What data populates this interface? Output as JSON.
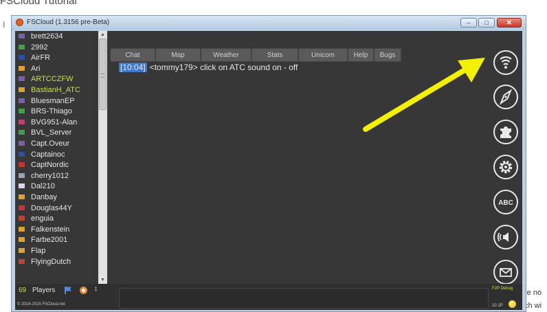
{
  "page": {
    "title": "FSCloud Tutorial",
    "side_text": "I",
    "right_text_1": "re no",
    "right_text_2": "ch wi"
  },
  "window": {
    "title": "FSCloud (1.3156 pre-Beta)",
    "buttons": {
      "minimize": "–",
      "maximize": "□",
      "close": "✕"
    }
  },
  "players": {
    "items": [
      {
        "name": "brett2634",
        "flag": "#7a5fb0",
        "atc": false
      },
      {
        "name": "2992",
        "flag": "#3fa04a",
        "atc": false
      },
      {
        "name": "AirFR",
        "flag": "#2a4fb0",
        "atc": false
      },
      {
        "name": "Ari",
        "flag": "#e2a12a",
        "atc": false
      },
      {
        "name": "ARTCCZFW",
        "flag": "#7a5fb0",
        "atc": true
      },
      {
        "name": "BastianH_ATC",
        "flag": "#e2a12a",
        "atc": true
      },
      {
        "name": "BluesmanEP",
        "flag": "#7a5fb0",
        "atc": false
      },
      {
        "name": "BRS-Thiago",
        "flag": "#3fa04a",
        "atc": false
      },
      {
        "name": "BVG951-Alan",
        "flag": "#c04070",
        "atc": false
      },
      {
        "name": "BVL_Server",
        "flag": "#3fa04a",
        "atc": false
      },
      {
        "name": "Capt.Oveur",
        "flag": "#7a5fb0",
        "atc": false
      },
      {
        "name": "Captainoc",
        "flag": "#2a4fb0",
        "atc": false
      },
      {
        "name": "CaptNordic",
        "flag": "#d03030",
        "atc": false
      },
      {
        "name": "cherry1012",
        "flag": "#9aa0b8",
        "atc": false
      },
      {
        "name": "Dal210",
        "flag": "#d8d8e8",
        "atc": false
      },
      {
        "name": "Danbay",
        "flag": "#e2a12a",
        "atc": false
      },
      {
        "name": "Douglas44Y",
        "flag": "#d03030",
        "atc": false
      },
      {
        "name": "enguia",
        "flag": "#c04030",
        "atc": false
      },
      {
        "name": "Falkenstein",
        "flag": "#e2a12a",
        "atc": false
      },
      {
        "name": "Farbe2001",
        "flag": "#e2a12a",
        "atc": false
      },
      {
        "name": "Flap",
        "flag": "#e2a12a",
        "atc": false
      },
      {
        "name": "FlyingDutch",
        "flag": "#c04040",
        "atc": false
      }
    ],
    "count": "69",
    "label": "Players",
    "copyright": "© 2014-2015 FSCloud.net"
  },
  "tabs": [
    "Chat",
    "Map",
    "Weather",
    "Stats",
    "Unicom",
    "Help",
    "Bugs"
  ],
  "chat": {
    "timestamp": "[10:04]",
    "message": "<tommy179> click on ATC sound on - off"
  },
  "side_tools": {
    "icons": [
      "radio-waves-icon",
      "compass-icon",
      "puzzle-icon",
      "gear-icon",
      "abc-icon",
      "speaker-icon",
      "mail-icon"
    ],
    "abc_label": "ABC"
  },
  "footer": {
    "debug_label": "F2P Debug",
    "mini_status": "10 1P"
  },
  "colors": {
    "accent_green": "#c8e04a",
    "arrow_yellow": "#f3f000",
    "panel_bg": "#373737",
    "timestamp_bg": "#3d78c9"
  }
}
